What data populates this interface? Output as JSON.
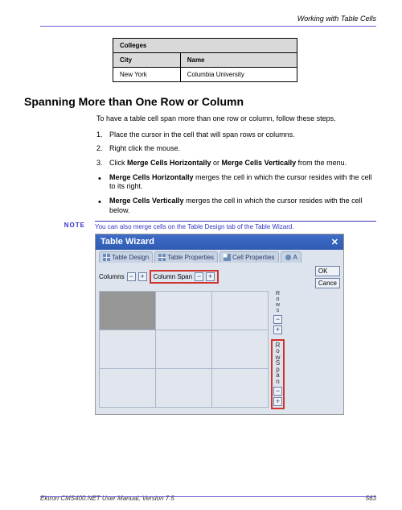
{
  "header": {
    "section_title": "Working with Table Cells"
  },
  "example_table": {
    "merged_header": "Colleges",
    "col1_header": "City",
    "col2_header": "Name",
    "row1_col1": "New York",
    "row1_col2": "Columbia University"
  },
  "section": {
    "heading": "Spanning More than One Row or Column",
    "intro": "To have a table cell span more than one row or column, follow these steps.",
    "steps": {
      "s1": "Place the cursor in the cell that will span rows or columns.",
      "s2": "Right click the mouse.",
      "s3a": "Click ",
      "s3b": "Merge Cells Horizontally",
      "s3c": " or ",
      "s3d": "Merge Cells Vertically",
      "s3e": " from the menu."
    },
    "bullets": {
      "b1a": "Merge Cells Horizontally",
      "b1b": " merges the cell in which the cursor resides with the cell to its right.",
      "b2a": "Merge Cells Vertically",
      "b2b": " merges the cell in which the cursor resides with the cell below."
    }
  },
  "note": {
    "label": "NOTE",
    "text": "You can also merge cells on the Table Design tab of the Table Wizard."
  },
  "wizard": {
    "title": "Table Wizard",
    "tabs": {
      "t1": "Table Design",
      "t2": "Table Properties",
      "t3": "Cell Properties",
      "t4": "A"
    },
    "columns_label": "Columns",
    "column_span_label": "Column Span",
    "rows_label": "R\no\nw\ns",
    "row_span_label": "R\no\nw\nS\np\na\nn",
    "minus": "−",
    "plus": "+",
    "ok": "OK",
    "cancel": "Cance"
  },
  "footer": {
    "left": "Ektron CMS400.NET User Manual, Version 7.5",
    "right": "563"
  }
}
